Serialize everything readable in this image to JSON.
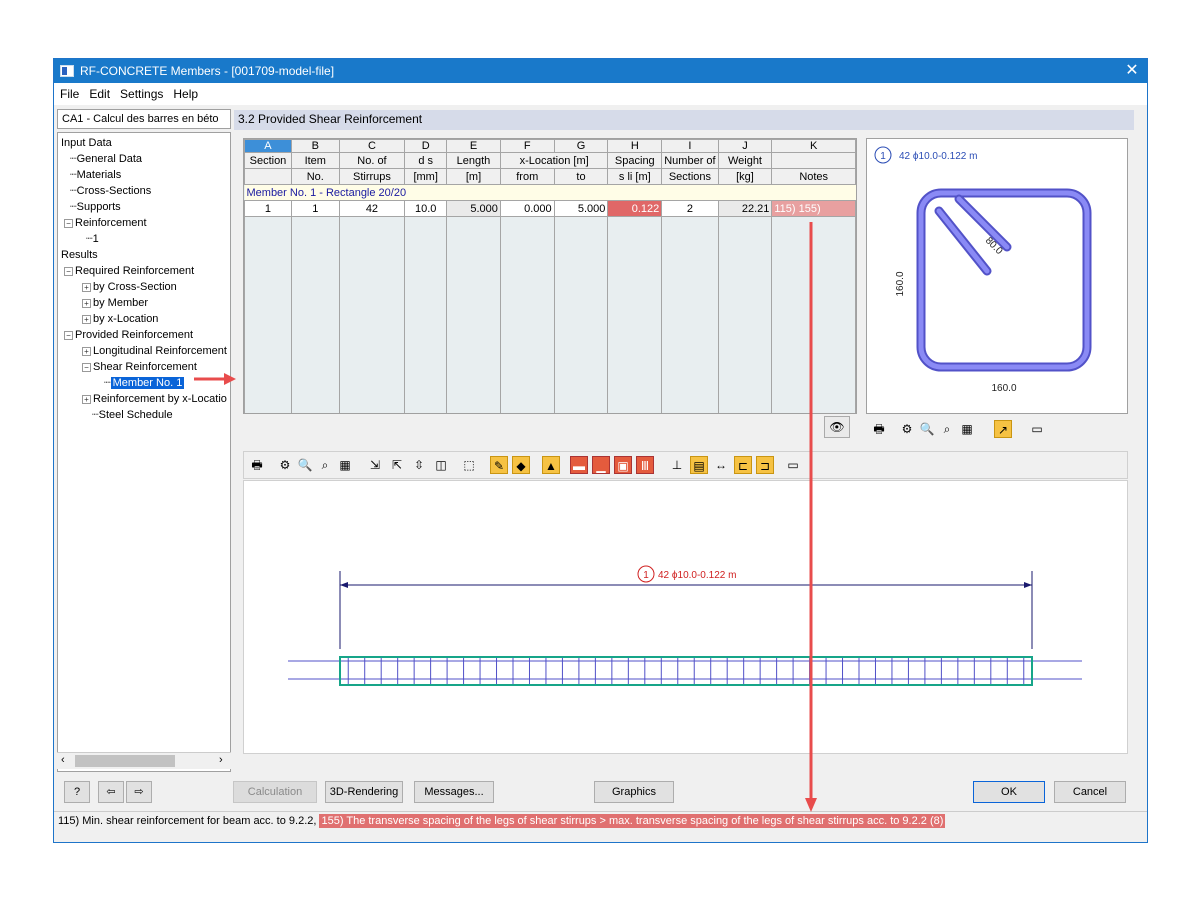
{
  "window": {
    "title": "RF-CONCRETE Members - [001709-model-file]",
    "close": "✕"
  },
  "menu": [
    "File",
    "Edit",
    "Settings",
    "Help"
  ],
  "case_select": "CA1 - Calcul des barres en béto",
  "tree": {
    "input_data": "Input Data",
    "general_data": "General Data",
    "materials": "Materials",
    "cross_sections": "Cross-Sections",
    "supports": "Supports",
    "reinforcement": "Reinforcement",
    "reinforcement_1": "1",
    "results": "Results",
    "required_reinforcement": "Required Reinforcement",
    "by_cross_section": "by Cross-Section",
    "by_member": "by Member",
    "by_x_location": "by x-Location",
    "provided_reinforcement": "Provided Reinforcement",
    "longitudinal_reinforcement": "Longitudinal Reinforcement",
    "shear_reinforcement": "Shear Reinforcement",
    "member_no_1": "Member No. 1",
    "reinforcement_by_x": "Reinforcement by x-Locatio",
    "steel_schedule": "Steel Schedule"
  },
  "panel_title": "3.2  Provided Shear Reinforcement",
  "table": {
    "letters": [
      "A",
      "B",
      "C",
      "D",
      "E",
      "F",
      "G",
      "H",
      "I",
      "J",
      "K"
    ],
    "header1": {
      "a": "Section",
      "b": "Item",
      "c": "No. of",
      "d": "d s",
      "e": "Length",
      "fg": "x-Location [m]",
      "h": "Spacing",
      "i": "Number of",
      "j": "Weight",
      "k": ""
    },
    "header2": {
      "a": "",
      "b": "No.",
      "c": "Stirrups",
      "d": "[mm]",
      "e": "[m]",
      "f": "from",
      "g": "to",
      "h": "s li [m]",
      "i": "Sections",
      "j": "[kg]",
      "k": "Notes"
    },
    "member_row": "Member No. 1  -  Rectangle 20/20",
    "row": {
      "section": "1",
      "item": "1",
      "stirrups": "42",
      "ds": "10.0",
      "length": "5.000",
      "from": "0.000",
      "to": "5.000",
      "spacing": "0.122",
      "sections": "2",
      "weight": "22.21",
      "notes": "115) 155)"
    }
  },
  "cross_section": {
    "marker": "1",
    "label": "42 ϕ10.0-0.122 m",
    "dim_h": "160.0",
    "dim_v": "160.0",
    "hook": "80.0"
  },
  "member_view": {
    "marker": "1",
    "label": "42 ϕ10.0-0.122 m"
  },
  "buttons": {
    "calculation": "Calculation",
    "rendering": "3D-Rendering",
    "messages": "Messages...",
    "graphics": "Graphics",
    "ok": "OK",
    "cancel": "Cancel"
  },
  "status": {
    "part1": "115) Min. shear reinforcement for beam acc. to 9.2.2,",
    "part2": "155) The transverse spacing of the legs of shear stirrups > max. transverse spacing of the legs of shear stirrups acc. to 9.2.2 (8)"
  },
  "colors": {
    "accent": "#1979ca",
    "highlight": "#e06767",
    "stirrup": "#6a6af0",
    "beam": "#17a589",
    "arrow": "#e84c4c"
  }
}
